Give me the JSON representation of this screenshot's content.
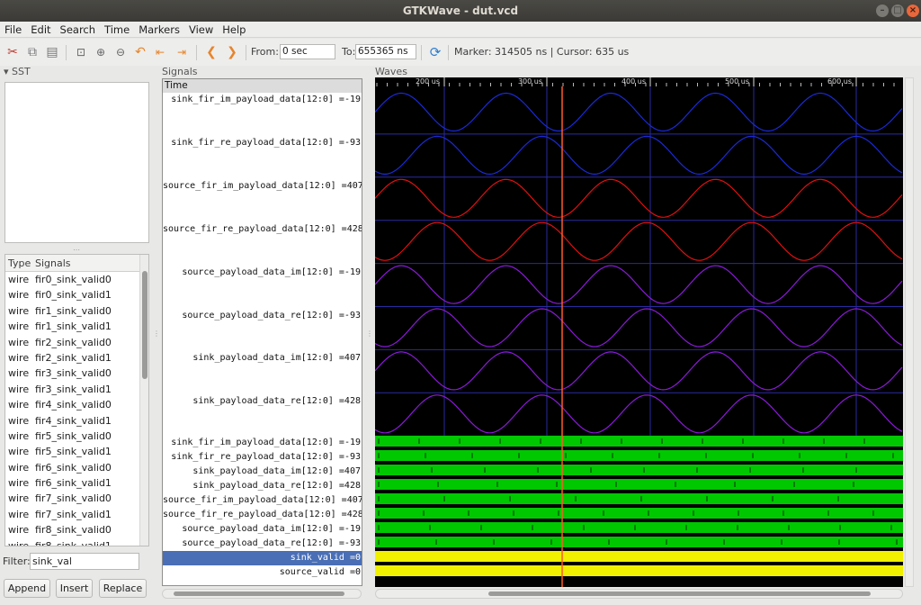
{
  "window": {
    "title": "GTKWave - dut.vcd"
  },
  "menu": [
    "File",
    "Edit",
    "Search",
    "Time",
    "Markers",
    "View",
    "Help"
  ],
  "toolbar": {
    "from_label": "From:",
    "from_value": "0 sec",
    "to_label": "To:",
    "to_value": "655365 ns",
    "status": "Marker: 314505 ns  |  Cursor: 635 us"
  },
  "sst": {
    "title": "SST"
  },
  "signal_list": {
    "headers": [
      "Type",
      "Signals"
    ],
    "rows": [
      [
        "wire",
        "fir0_sink_valid0"
      ],
      [
        "wire",
        "fir0_sink_valid1"
      ],
      [
        "wire",
        "fir1_sink_valid0"
      ],
      [
        "wire",
        "fir1_sink_valid1"
      ],
      [
        "wire",
        "fir2_sink_valid0"
      ],
      [
        "wire",
        "fir2_sink_valid1"
      ],
      [
        "wire",
        "fir3_sink_valid0"
      ],
      [
        "wire",
        "fir3_sink_valid1"
      ],
      [
        "wire",
        "fir4_sink_valid0"
      ],
      [
        "wire",
        "fir4_sink_valid1"
      ],
      [
        "wire",
        "fir5_sink_valid0"
      ],
      [
        "wire",
        "fir5_sink_valid1"
      ],
      [
        "wire",
        "fir6_sink_valid0"
      ],
      [
        "wire",
        "fir6_sink_valid1"
      ],
      [
        "wire",
        "fir7_sink_valid0"
      ],
      [
        "wire",
        "fir7_sink_valid1"
      ],
      [
        "wire",
        "fir8_sink_valid0"
      ],
      [
        "wire",
        "fir8_sink_valid1"
      ]
    ]
  },
  "filter": {
    "label": "Filter:",
    "value": "sink_val"
  },
  "buttons": {
    "append": "Append",
    "insert": "Insert",
    "replace": "Replace"
  },
  "signals_panel": {
    "title": "Signals",
    "time_label": "Time",
    "analog": [
      {
        "label": "sink_fir_im_payload_data[12:0] =-19",
        "color": "#1a2ad8"
      },
      {
        "label": "sink_fir_re_payload_data[12:0] =-93",
        "color": "#1a2ad8"
      },
      {
        "label": "source_fir_im_payload_data[12:0] =407",
        "color": "#e01010"
      },
      {
        "label": "source_fir_re_payload_data[12:0] =428",
        "color": "#e01010"
      },
      {
        "label": "source_payload_data_im[12:0] =-19",
        "color": "#8a1ad8"
      },
      {
        "label": "source_payload_data_re[12:0] =-93",
        "color": "#8a1ad8"
      },
      {
        "label": "sink_payload_data_im[12:0] =407",
        "color": "#8a1ad8"
      },
      {
        "label": "sink_payload_data_re[12:0] =428",
        "color": "#8a1ad8"
      }
    ],
    "digital": [
      "sink_fir_im_payload_data[12:0] =-19",
      "sink_fir_re_payload_data[12:0] =-93",
      "sink_payload_data_im[12:0] =407",
      "sink_payload_data_re[12:0] =428",
      "source_fir_im_payload_data[12:0] =407",
      "source_fir_re_payload_data[12:0] =428",
      "source_payload_data_im[12:0] =-19",
      "source_payload_data_re[12:0] =-93"
    ],
    "bits": [
      {
        "label": "sink_valid =0",
        "selected": true
      },
      {
        "label": "source_valid =0",
        "selected": false
      }
    ]
  },
  "waves": {
    "title": "Waves",
    "ticks": [
      "200 us",
      "300 us",
      "400 us",
      "500 us",
      "600 us"
    ],
    "bus_color": "#00c800",
    "bit_color": "#f0f000",
    "marker_color": "#ff5a2a"
  }
}
